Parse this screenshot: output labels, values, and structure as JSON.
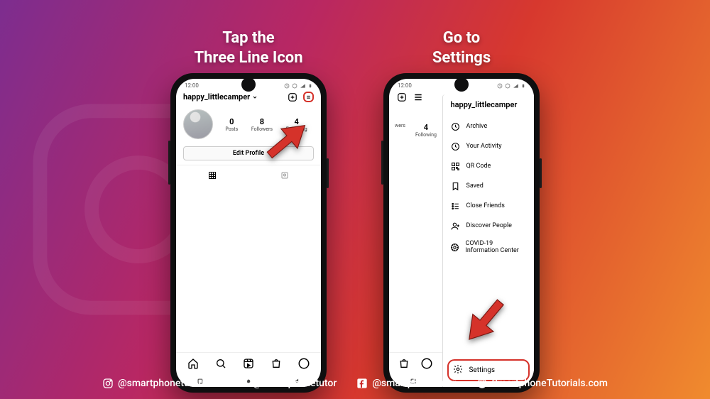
{
  "captions": {
    "left_l1": "Tap the",
    "left_l2": "Three Line Icon",
    "right_l1": "Go to",
    "right_l2": "Settings"
  },
  "status": {
    "time": "12:00"
  },
  "profile": {
    "username": "happy_littlecamper",
    "stats": [
      {
        "n": "0",
        "l": "Posts"
      },
      {
        "n": "8",
        "l": "Followers"
      },
      {
        "n": "4",
        "l": "Following"
      }
    ],
    "edit_label": "Edit Profile"
  },
  "drawer": {
    "username": "happy_littlecamper",
    "items": [
      {
        "label": "Archive",
        "icon": "archive"
      },
      {
        "label": "Your Activity",
        "icon": "activity"
      },
      {
        "label": "QR Code",
        "icon": "qr"
      },
      {
        "label": "Saved",
        "icon": "saved"
      },
      {
        "label": "Close Friends",
        "icon": "list"
      },
      {
        "label": "Discover People",
        "icon": "person-add"
      },
      {
        "label": "COVID-19 Information Center",
        "icon": "info"
      }
    ],
    "settings_label": "Settings"
  },
  "behind_stats": [
    {
      "n": "",
      "l": "wers"
    },
    {
      "n": "4",
      "l": "Following"
    }
  ],
  "footer": {
    "ig": "@smartphonetutorials",
    "tw": "@smartphonetutor",
    "fb": "@smartphonetutor",
    "web": "SmartphoneTutorials.com"
  }
}
